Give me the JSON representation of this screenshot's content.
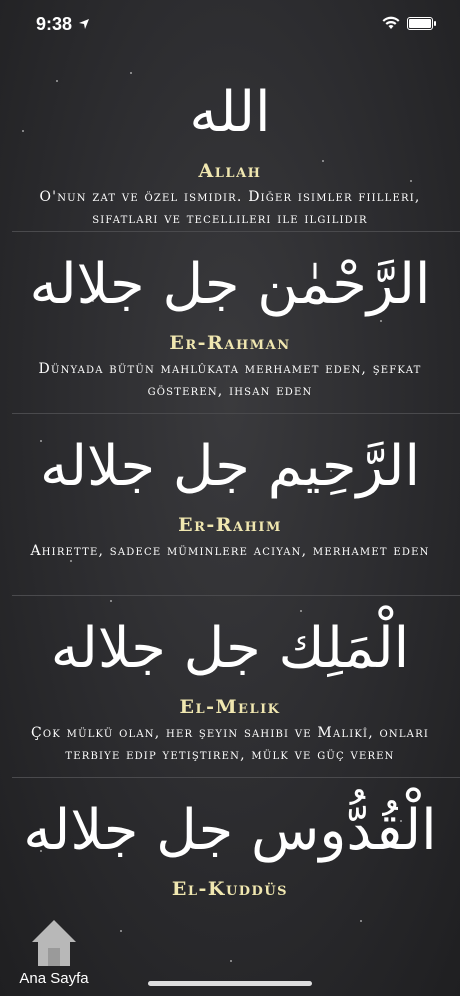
{
  "status_bar": {
    "time": "9:38"
  },
  "names": [
    {
      "arabic": "الله",
      "name": "Allah",
      "description": "O'nun zat ve özel ısmıdır. Dıǧer ısımler fıılleri, sıfatları ve tecellılerı ıle ılgılıdır"
    },
    {
      "arabic": "الرَّحْمٰن جل جلاله",
      "name": "Er-Rahman",
      "description": "Dünyada bütün mahlûkata merhamet eden, şefkat gösteren, ıhsan eden"
    },
    {
      "arabic": "الرَّحِيم جل جلاله",
      "name": "Er-Rahım",
      "description": "Ahırette, sadece mümınlere acıyan, merhamet eden"
    },
    {
      "arabic": "الْمَلِك جل جلاله",
      "name": "El-Melık",
      "description": "Çok mülkü olan, her şeyın sahıbı ve Malıkî, onları terbıye edıp yetıştıren, mülk ve güç veren"
    },
    {
      "arabic": "الْقُدُّوس جل جلاله",
      "name": "El-Kuddüs",
      "description": ""
    }
  ],
  "tab_bar": {
    "home_label": "Ana Sayfa"
  },
  "colors": {
    "name_color": "#f0e7b0",
    "text_color": "#ffffff",
    "background": "#2b2b2e"
  }
}
